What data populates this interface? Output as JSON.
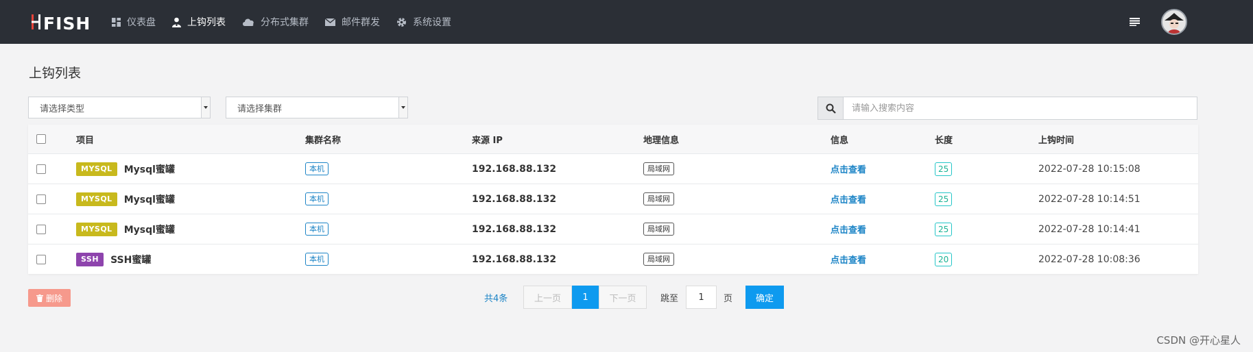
{
  "nav": {
    "items": [
      {
        "label": "仪表盘",
        "icon": "dashboard-icon",
        "active": false
      },
      {
        "label": "上钩列表",
        "icon": "user-hook-icon",
        "active": true
      },
      {
        "label": "分布式集群",
        "icon": "cloud-icon",
        "active": false
      },
      {
        "label": "邮件群发",
        "icon": "mail-icon",
        "active": false
      },
      {
        "label": "系统设置",
        "icon": "gear-icon",
        "active": false
      }
    ]
  },
  "page": {
    "title": "上钩列表"
  },
  "filters": {
    "type_placeholder": "请选择类型",
    "cluster_placeholder": "请选择集群",
    "search_placeholder": "请输入搜索内容"
  },
  "table": {
    "headers": {
      "project": "项目",
      "cluster": "集群名称",
      "ip": "来源 IP",
      "geo": "地理信息",
      "info": "信息",
      "length": "长度",
      "time": "上钩时间"
    },
    "rows": [
      {
        "type": "MYSQL",
        "type_color": "#c8b91d",
        "name": "Mysql蜜罐",
        "cluster": "本机",
        "ip": "192.168.88.132",
        "geo": "局域网",
        "info": "点击查看",
        "length": "25",
        "time": "2022-07-28 10:15:08"
      },
      {
        "type": "MYSQL",
        "type_color": "#c8b91d",
        "name": "Mysql蜜罐",
        "cluster": "本机",
        "ip": "192.168.88.132",
        "geo": "局域网",
        "info": "点击查看",
        "length": "25",
        "time": "2022-07-28 10:14:51"
      },
      {
        "type": "MYSQL",
        "type_color": "#c8b91d",
        "name": "Mysql蜜罐",
        "cluster": "本机",
        "ip": "192.168.88.132",
        "geo": "局域网",
        "info": "点击查看",
        "length": "25",
        "time": "2022-07-28 10:14:41"
      },
      {
        "type": "SSH",
        "type_color": "#8e44ad",
        "name": "SSH蜜罐",
        "cluster": "本机",
        "ip": "192.168.88.132",
        "geo": "局域网",
        "info": "点击查看",
        "length": "20",
        "time": "2022-07-28 10:08:36"
      }
    ]
  },
  "actions": {
    "delete_label": "删除"
  },
  "pagination": {
    "total": "共4条",
    "prev": "上一页",
    "current": "1",
    "next": "下一页",
    "jump_to": "跳至",
    "jump_value": "1",
    "page_unit": "页",
    "confirm": "确定"
  },
  "watermark": "CSDN @开心星人"
}
